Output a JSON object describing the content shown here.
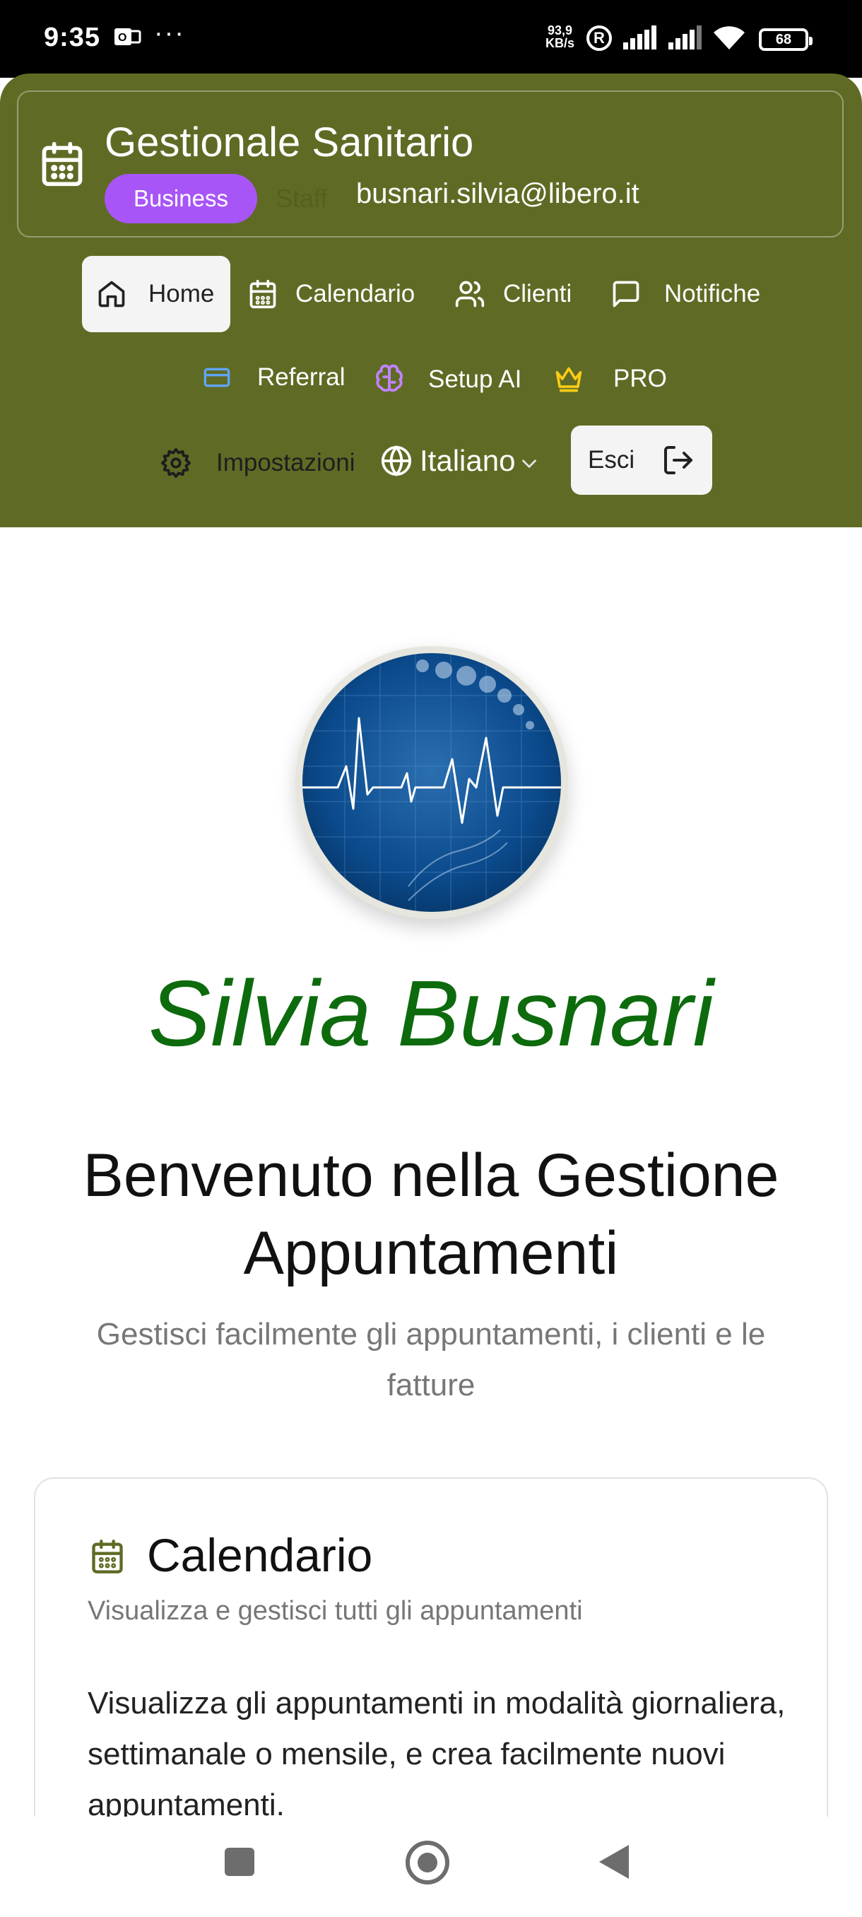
{
  "status_bar": {
    "time": "9:35",
    "speed_top": "93,9",
    "speed_bottom": "KB/s",
    "registered": "R",
    "battery": "68",
    "dots": "···"
  },
  "header": {
    "app_title": "Gestionale Sanitario",
    "plan_badge": "Business",
    "role_label": "Staff",
    "email": "busnari.silvia@libero.it",
    "nav": {
      "home": "Home",
      "calendar": "Calendario",
      "clients": "Clienti",
      "notifications": "Notifiche",
      "referral": "Referral",
      "setup_ai": "Setup AI",
      "pro": "PRO",
      "settings": "Impostazioni",
      "language": "Italiano",
      "logout": "Esci"
    },
    "colors": {
      "background": "#5f6b25",
      "badge": "#a855f7",
      "referral_icon": "#60a5fa",
      "setup_ai_icon": "#c084fc",
      "pro_icon": "#facc15"
    }
  },
  "main": {
    "name": "Silvia Busnari",
    "welcome_title": "Benvenuto nella Gestione Appuntamenti",
    "welcome_subtitle": "Gestisci facilmente gli appuntamenti, i clienti e le fatture",
    "card": {
      "icon": "calendar-icon",
      "title": "Calendario",
      "subtitle": "Visualizza e gestisci tutti gli appuntamenti",
      "body": "Visualizza gli appuntamenti in modalità giornaliera, settimanale o mensile, e crea facilmente nuovi appuntamenti."
    },
    "colors": {
      "name": "#0d6b0d"
    }
  }
}
